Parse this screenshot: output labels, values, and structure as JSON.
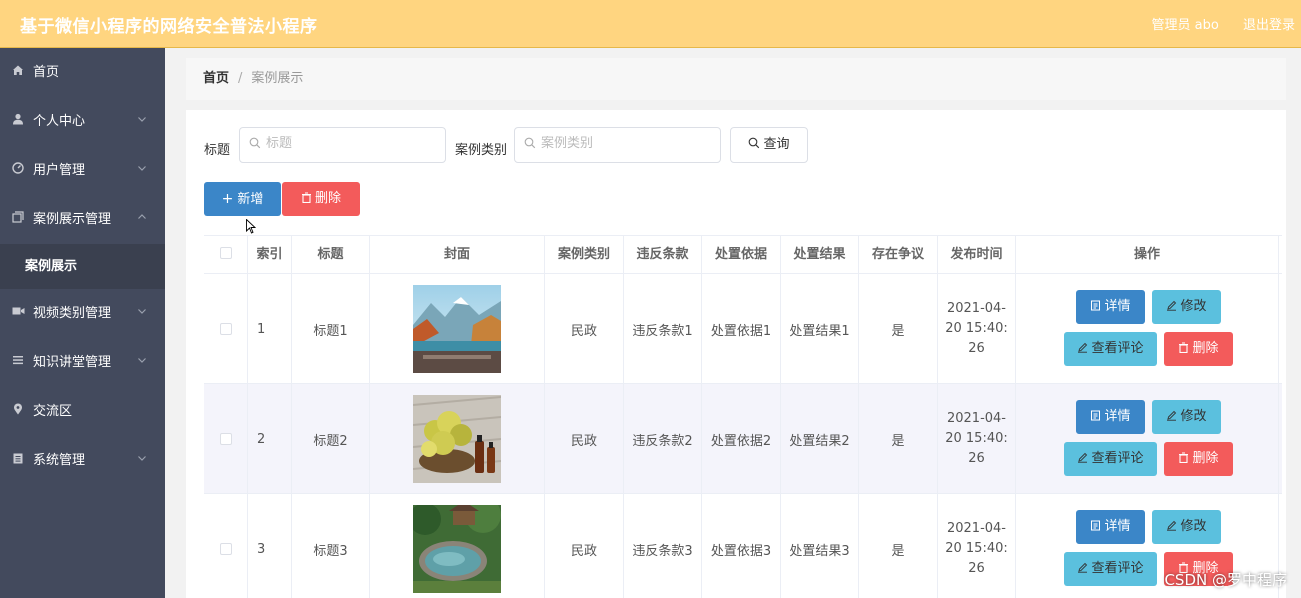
{
  "app": {
    "title": "基于微信小程序的网络安全普法小程序"
  },
  "header": {
    "user": "管理员 abo",
    "logout": "退出登录"
  },
  "sidebar": {
    "items": [
      {
        "label": "首页",
        "icon": "home-icon"
      },
      {
        "label": "个人中心",
        "icon": "user-icon"
      },
      {
        "label": "用户管理",
        "icon": "gauge-icon"
      },
      {
        "label": "案例展示管理",
        "icon": "copy-icon",
        "expanded": true
      },
      {
        "label": "案例展示",
        "icon": "",
        "sub": true
      },
      {
        "label": "视频类别管理",
        "icon": "video-icon"
      },
      {
        "label": "知识讲堂管理",
        "icon": "list-icon"
      },
      {
        "label": "交流区",
        "icon": "location-icon"
      },
      {
        "label": "系统管理",
        "icon": "clipboard-icon"
      }
    ]
  },
  "breadcrumb": {
    "home": "首页",
    "separator": "/",
    "current": "案例展示"
  },
  "search": {
    "title_label": "标题",
    "title_placeholder": "标题",
    "category_label": "案例类别",
    "category_placeholder": "案例类别",
    "query_button": "查询"
  },
  "toolbar": {
    "add": "新增",
    "delete": "删除"
  },
  "table": {
    "columns": [
      "索引",
      "标题",
      "封面",
      "案例类别",
      "违反条款",
      "处置依据",
      "处置结果",
      "存在争议",
      "发布时间",
      "操作"
    ],
    "rows": [
      {
        "index": "1",
        "title": "标题1",
        "category": "民政",
        "clause": "违反条款1",
        "basis": "处置依据1",
        "result": "处置结果1",
        "dispute": "是",
        "time": "2021-04-20 15:40:26"
      },
      {
        "index": "2",
        "title": "标题2",
        "category": "民政",
        "clause": "违反条款2",
        "basis": "处置依据2",
        "result": "处置结果2",
        "dispute": "是",
        "time": "2021-04-20 15:40:26"
      },
      {
        "index": "3",
        "title": "标题3",
        "category": "民政",
        "clause": "违反条款3",
        "basis": "处置依据3",
        "result": "处置结果3",
        "dispute": "是",
        "time": "2021-04-20 15:40:26"
      }
    ],
    "actions": {
      "detail": "详情",
      "edit": "修改",
      "comments": "查看评论",
      "delete": "删除"
    }
  },
  "watermark": "CSDN @罗中程序",
  "colors": {
    "topbar": "#ffd580",
    "sidebar": "#434a5d",
    "primary": "#3b86c8",
    "info": "#5bc0de",
    "danger": "#f35b5b"
  }
}
